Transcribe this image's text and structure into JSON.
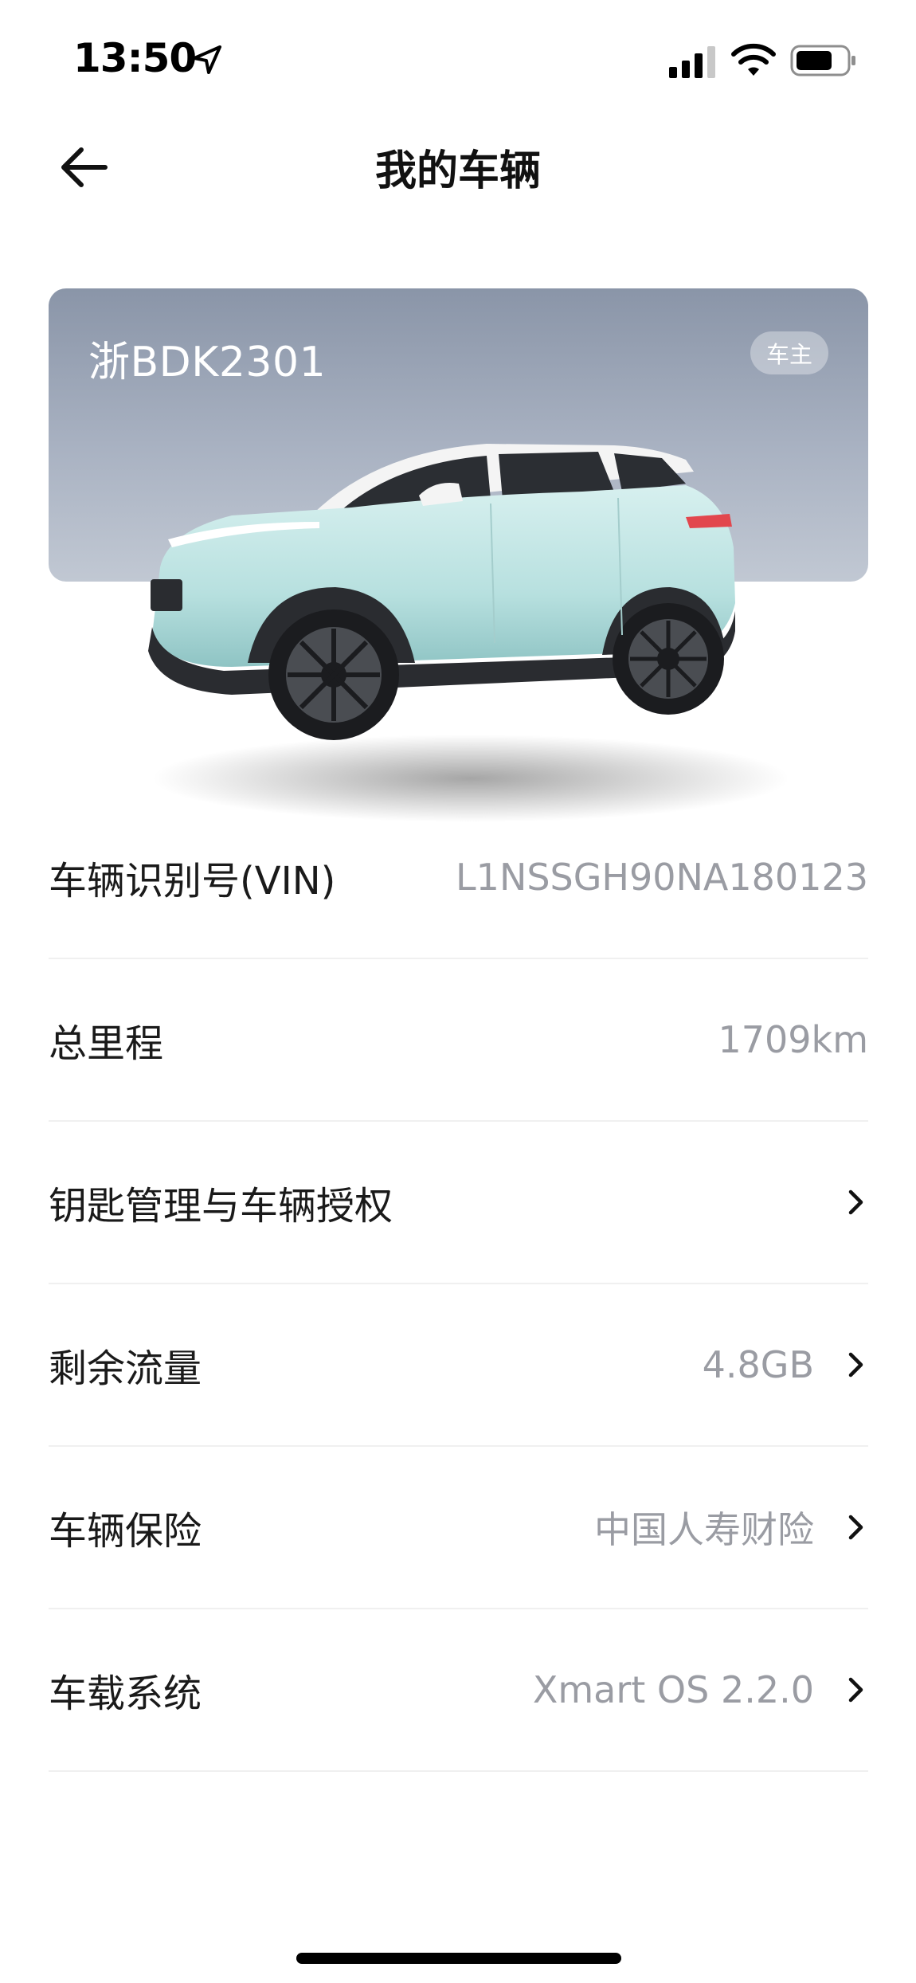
{
  "status_bar": {
    "time": "13:50"
  },
  "nav": {
    "title": "我的车辆"
  },
  "vehicle_card": {
    "plate": "浙BDK2301",
    "badge": "车主"
  },
  "info_rows": [
    {
      "label": "车辆识别号(VIN)",
      "value": "L1NSSGH90NA180123",
      "has_chevron": false
    },
    {
      "label": "总里程",
      "value": "1709km",
      "has_chevron": false
    },
    {
      "label": "钥匙管理与车辆授权",
      "value": "",
      "has_chevron": true
    },
    {
      "label": "剩余流量",
      "value": "4.8GB",
      "has_chevron": true
    },
    {
      "label": "车辆保险",
      "value": "中国人寿财险",
      "has_chevron": true
    },
    {
      "label": "车载系统",
      "value": "Xmart OS 2.2.0",
      "has_chevron": true
    }
  ]
}
